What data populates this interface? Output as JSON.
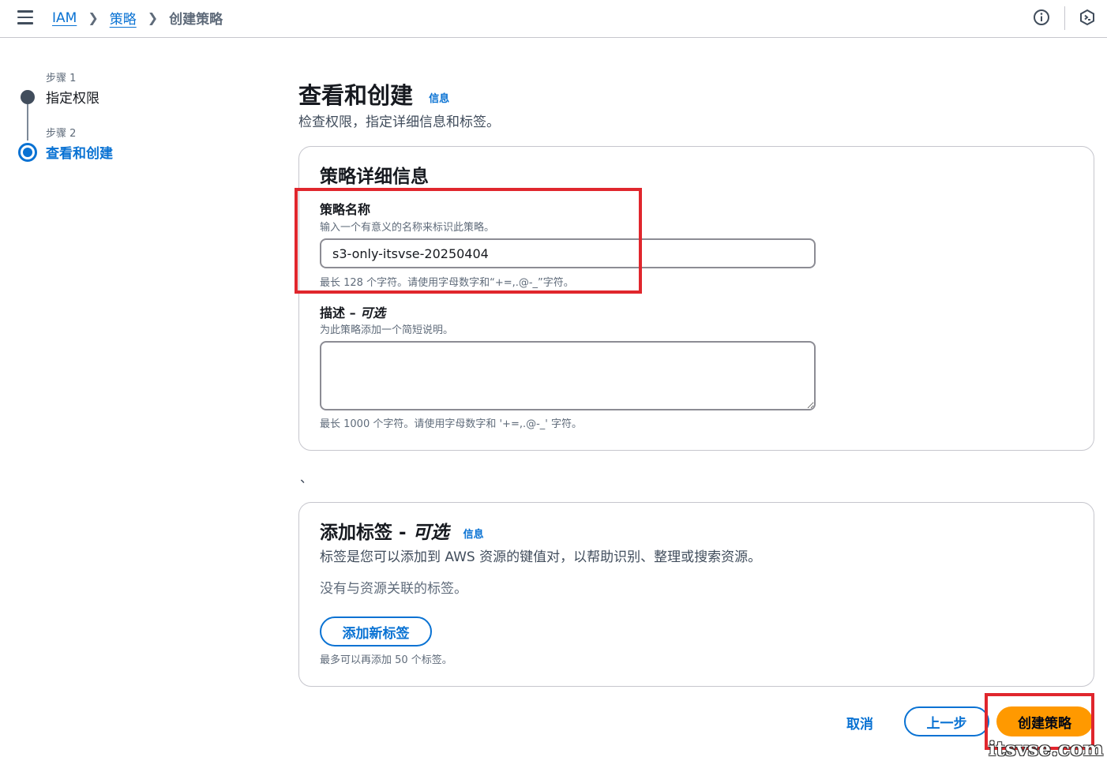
{
  "breadcrumb": {
    "items": [
      {
        "label": "IAM"
      },
      {
        "label": "策略"
      }
    ],
    "current": "创建策略"
  },
  "topbar": {
    "icons": [
      "info-icon",
      "cloudshell-icon"
    ]
  },
  "steps": [
    {
      "sub": "步骤 1",
      "label": "指定权限",
      "state": "done"
    },
    {
      "sub": "步骤 2",
      "label": "查看和创建",
      "state": "active"
    }
  ],
  "page": {
    "title": "查看和创建",
    "info_label": "信息",
    "description": "检查权限，指定详细信息和标签。"
  },
  "details_card": {
    "title": "策略详细信息",
    "name_field": {
      "label": "策略名称",
      "description": "输入一个有意义的名称来标识此策略。",
      "value": "s3-only-itsvse-20250404",
      "constraint": "最长 128 个字符。请使用字母数字和“+=,.@-_”字符。"
    },
    "description_field": {
      "label": "描述 – ",
      "optional": "可选",
      "description": "为此策略添加一个简短说明。",
      "value": "",
      "constraint": "最长 1000 个字符。请使用字母数字和 '+=,.@-_' 字符。"
    }
  },
  "stray_mark": "、",
  "tags_card": {
    "title": "添加标签 - ",
    "optional": "可选",
    "info_label": "信息",
    "description": "标签是您可以添加到 AWS 资源的键值对，以帮助识别、整理或搜索资源。",
    "empty_text": "没有与资源关联的标签。",
    "add_button": "添加新标签",
    "limit_text": "最多可以再添加 50 个标签。"
  },
  "footer": {
    "cancel": "取消",
    "previous": "上一步",
    "create": "创建策略"
  },
  "watermark": "itsvse.com",
  "colors": {
    "link": "#0972d3",
    "primary": "#ff9900",
    "highlight": "#e0262d",
    "text": "#16191f",
    "muted": "#5f6b7a"
  }
}
